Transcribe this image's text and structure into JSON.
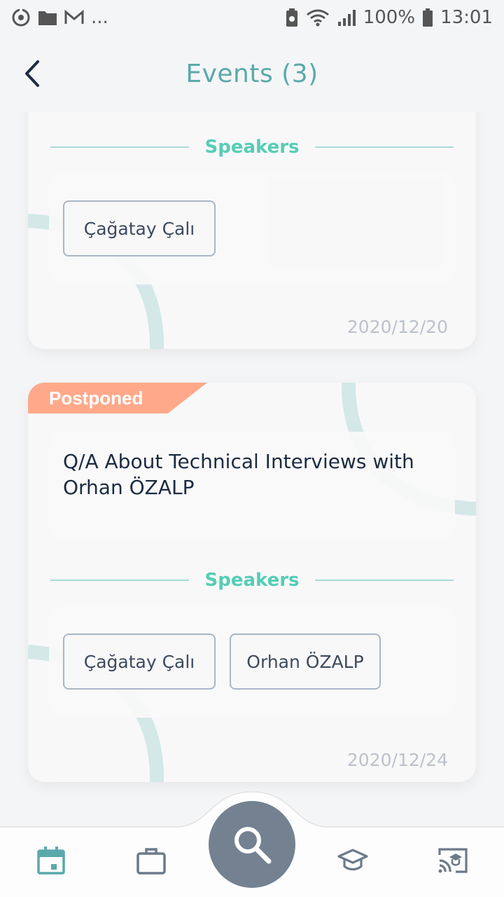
{
  "status_bar": {
    "left_icons": [
      "sync-icon",
      "folder-icon",
      "gmail-icon"
    ],
    "left_more": "...",
    "battery_percent": "100%",
    "time": "13:01"
  },
  "header": {
    "title": "Events (3)",
    "back_icon": "chevron-left-icon"
  },
  "events": [
    {
      "speakers_label": "Speakers",
      "speakers": [
        "Çağatay Çalı"
      ],
      "date": "2020/12/20"
    },
    {
      "status": "Postponed",
      "title": "Q/A About Technical Interviews with Orhan ÖZALP",
      "speakers_label": "Speakers",
      "speakers": [
        "Çağatay Çalı",
        "Orhan ÖZALP"
      ],
      "date": "2020/12/24"
    }
  ],
  "bottom_nav": {
    "items": [
      "calendar-icon",
      "briefcase-icon",
      "search-icon",
      "graduation-cap-icon",
      "cast-icon"
    ],
    "active": "calendar-icon"
  },
  "colors": {
    "accent": "#5aa9ab",
    "section_label": "#56cdb6",
    "ribbon": "#ffa98a",
    "fab": "#738190"
  }
}
